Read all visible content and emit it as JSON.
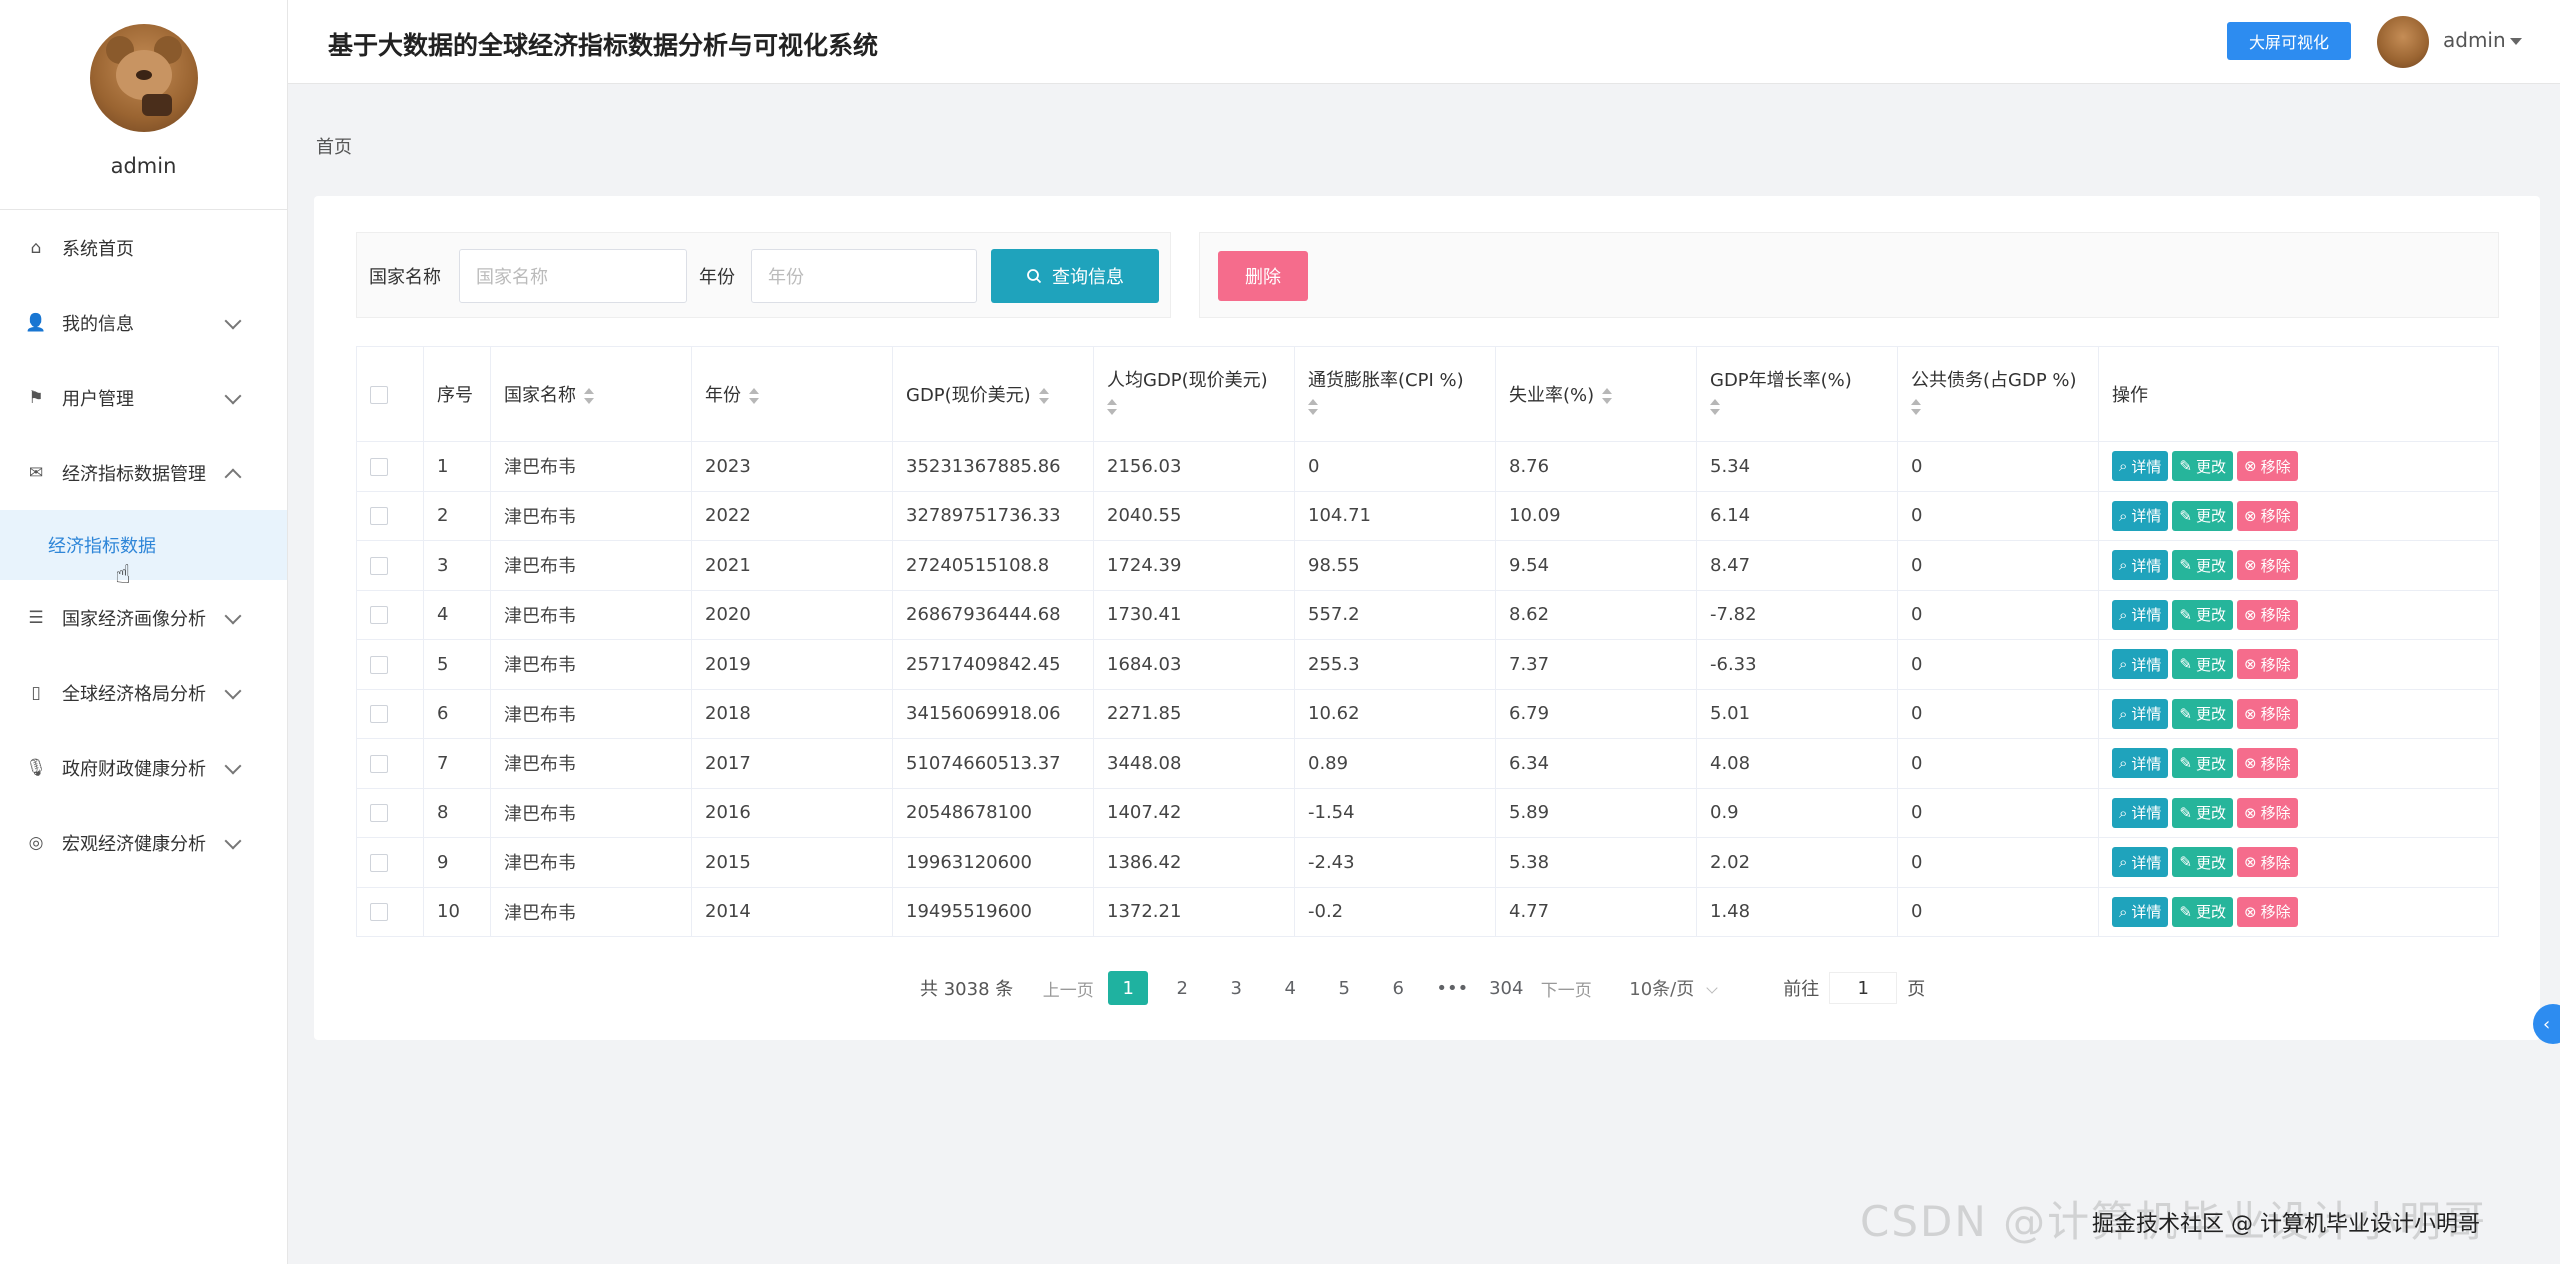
{
  "app": {
    "title": "基于大数据的全球经济指标数据分析与可视化系统"
  },
  "header": {
    "bigscreen_label": "大屏可视化",
    "user": "admin"
  },
  "profile": {
    "name": "admin"
  },
  "sidebar": {
    "items": [
      {
        "label": "系统首页",
        "icon": "home-icon"
      },
      {
        "label": "我的信息",
        "icon": "user-icon"
      },
      {
        "label": "用户管理",
        "icon": "flag-icon"
      },
      {
        "label": "经济指标数据管理",
        "icon": "mail-icon"
      },
      {
        "label": "经济指标数据",
        "sub": true
      },
      {
        "label": "国家经济画像分析",
        "icon": "sliders-icon"
      },
      {
        "label": "全球经济格局分析",
        "icon": "phone-icon"
      },
      {
        "label": "政府财政健康分析",
        "icon": "mic-icon"
      },
      {
        "label": "宏观经济健康分析",
        "icon": "globe-icon"
      }
    ]
  },
  "breadcrumb": "首页",
  "search": {
    "country_label": "国家名称",
    "country_placeholder": "国家名称",
    "year_label": "年份",
    "year_placeholder": "年份",
    "query_label": "查询信息",
    "delete_label": "删除"
  },
  "table": {
    "headers": [
      "序号",
      "国家名称",
      "年份",
      "GDP(现价美元)",
      "人均GDP(现价美元)",
      "通货膨胀率(CPI %)",
      "失业率(%)",
      "GDP年增长率(%)",
      "公共债务(占GDP %)",
      "操作"
    ],
    "actions": {
      "detail": "详情",
      "edit": "更改",
      "remove": "移除"
    },
    "rows": [
      [
        "1",
        "津巴布韦",
        "2023",
        "35231367885.86",
        "2156.03",
        "0",
        "8.76",
        "5.34",
        "0"
      ],
      [
        "2",
        "津巴布韦",
        "2022",
        "32789751736.33",
        "2040.55",
        "104.71",
        "10.09",
        "6.14",
        "0"
      ],
      [
        "3",
        "津巴布韦",
        "2021",
        "27240515108.8",
        "1724.39",
        "98.55",
        "9.54",
        "8.47",
        "0"
      ],
      [
        "4",
        "津巴布韦",
        "2020",
        "26867936444.68",
        "1730.41",
        "557.2",
        "8.62",
        "-7.82",
        "0"
      ],
      [
        "5",
        "津巴布韦",
        "2019",
        "25717409842.45",
        "1684.03",
        "255.3",
        "7.37",
        "-6.33",
        "0"
      ],
      [
        "6",
        "津巴布韦",
        "2018",
        "34156069918.06",
        "2271.85",
        "10.62",
        "6.79",
        "5.01",
        "0"
      ],
      [
        "7",
        "津巴布韦",
        "2017",
        "51074660513.37",
        "3448.08",
        "0.89",
        "6.34",
        "4.08",
        "0"
      ],
      [
        "8",
        "津巴布韦",
        "2016",
        "20548678100",
        "1407.42",
        "-1.54",
        "5.89",
        "0.9",
        "0"
      ],
      [
        "9",
        "津巴布韦",
        "2015",
        "19963120600",
        "1386.42",
        "-2.43",
        "5.38",
        "2.02",
        "0"
      ],
      [
        "10",
        "津巴布韦",
        "2014",
        "19495519600",
        "1372.21",
        "-0.2",
        "4.77",
        "1.48",
        "0"
      ]
    ]
  },
  "pagination": {
    "total": "共 3038 条",
    "prev": "上一页",
    "pages": [
      "1",
      "2",
      "3",
      "4",
      "5",
      "6",
      "•••",
      "304"
    ],
    "next": "下一页",
    "page_size": "10条/页",
    "goto_label": "前往",
    "goto_value": "1",
    "goto_unit": "页"
  },
  "watermark": "CSDN @计算机毕业设计小明哥",
  "watermark2": "掘金技术社区 @ 计算机毕业设计小明哥"
}
